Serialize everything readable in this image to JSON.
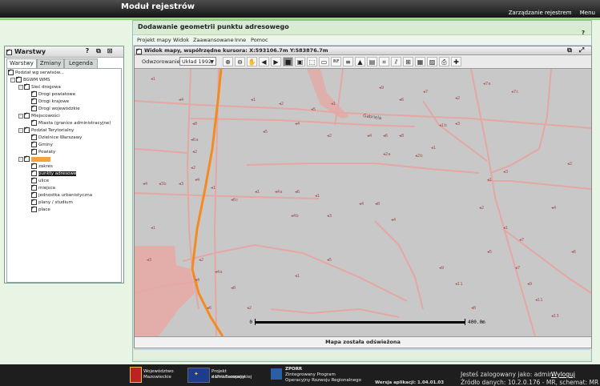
{
  "app": {
    "title": "Moduł rejestrów",
    "nav": [
      "Zarządzanie rejestrem",
      "Menu"
    ]
  },
  "layers_panel": {
    "title": "Warstwy",
    "header_buttons": [
      "?",
      "⧉",
      "⊠"
    ],
    "tabs": [
      "Warstwy",
      "Zmiany",
      "Legenda"
    ],
    "tree": [
      {
        "label": "Podział wg serwisów...",
        "level": 0,
        "selected": false
      },
      {
        "label": "BGWM WMS",
        "level": 1
      },
      {
        "label": "Sieć drogowa",
        "level": 2
      },
      {
        "label": "Drogi powiatowe",
        "level": 3
      },
      {
        "label": "Drogi krajowe",
        "level": 3
      },
      {
        "label": "Drogi wojewódzkie",
        "level": 3
      },
      {
        "label": "Miejscowości",
        "level": 2
      },
      {
        "label": "Miasta (granice administracyjne)",
        "level": 3
      },
      {
        "label": "Podział Terytorialny",
        "level": 2
      },
      {
        "label": "Dzielnice Warszawy",
        "level": 3
      },
      {
        "label": "Gminy",
        "level": 3
      },
      {
        "label": "Powiaty",
        "level": 3
      },
      {
        "label": "Rejestr...",
        "level": 2,
        "highlight": true
      },
      {
        "label": "zakres",
        "level": 3
      },
      {
        "label": "punkty adresowe",
        "level": 3,
        "selected": true
      },
      {
        "label": "ulice",
        "level": 3
      },
      {
        "label": "miejsca",
        "level": 3
      },
      {
        "label": "jednostka urbanistyczna",
        "level": 3
      },
      {
        "label": "plany / studium",
        "level": 3
      },
      {
        "label": "place",
        "level": 3
      }
    ]
  },
  "main_window": {
    "title": "Dodawanie geometrii punktu adresowego",
    "help": "?",
    "menu": [
      "Projekt mapy",
      "Widok",
      "Zaawansowane",
      "Inne",
      "Pomoc"
    ],
    "map_window": {
      "title": "Widok mapy, współrzędne kursora: X:593106.7m Y:583876.7m",
      "projection_label": "Odwzorowanie:",
      "projection_value": "Układ 1992",
      "tools": [
        "zoom-in",
        "zoom-out",
        "pan",
        "back",
        "forward",
        "full-extent",
        "zoom-box",
        "select",
        "measure",
        "identify",
        "info",
        "legend",
        "layers",
        "properties",
        "chart",
        "crosshair",
        "filter",
        "export",
        "print",
        "add-point"
      ],
      "scale_label": "400.0m",
      "scale_start": "0",
      "status": "Mapa została odświeżona",
      "street_label": "Gabriela"
    }
  },
  "footer": {
    "logos": [
      {
        "lines": [
          "Województwo",
          "Mazowieckie"
        ]
      },
      {
        "lines": [
          "Projekt dofinansowany",
          "z Unii Europejskiej"
        ]
      },
      {
        "lines": [
          "ZPORR",
          "Zintegrowany Program",
          "Operacyjny Rozwoju Regionalnego"
        ]
      }
    ],
    "version": "Wersja aplikacji: 1.04.01.03",
    "user_label": "Jesteś zalogowany jako: admin",
    "logout": "Wyloguj",
    "source": "Źródło danych: 10.2.0.176 - MR, schemat: MR"
  },
  "colors": {
    "accent": "#f4a43c",
    "road": "#e8aaa6",
    "route": "#f58a20",
    "map_bg": "#c9c9c9"
  }
}
